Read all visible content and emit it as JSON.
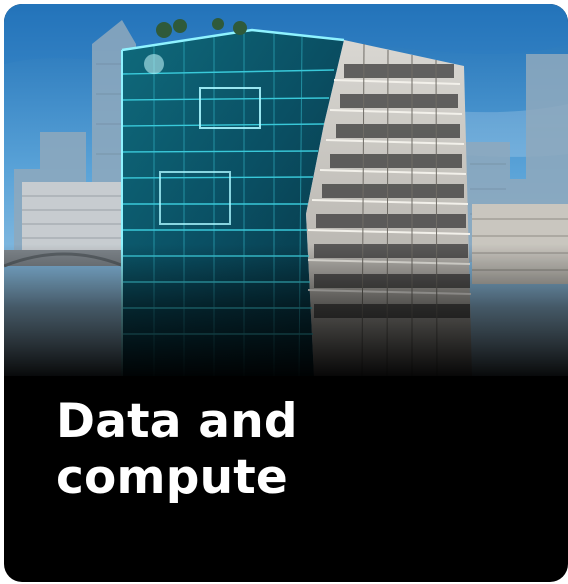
{
  "card": {
    "title": "Data and compute",
    "image_alt": "Building half rendered as a glowing cyan digital twin and half as a photo, city skyline behind"
  },
  "colors": {
    "card_background": "#000000",
    "title_text": "#ffffff",
    "digital_twin_accent": "#3fd6e6",
    "sky": "#3a86c8"
  }
}
